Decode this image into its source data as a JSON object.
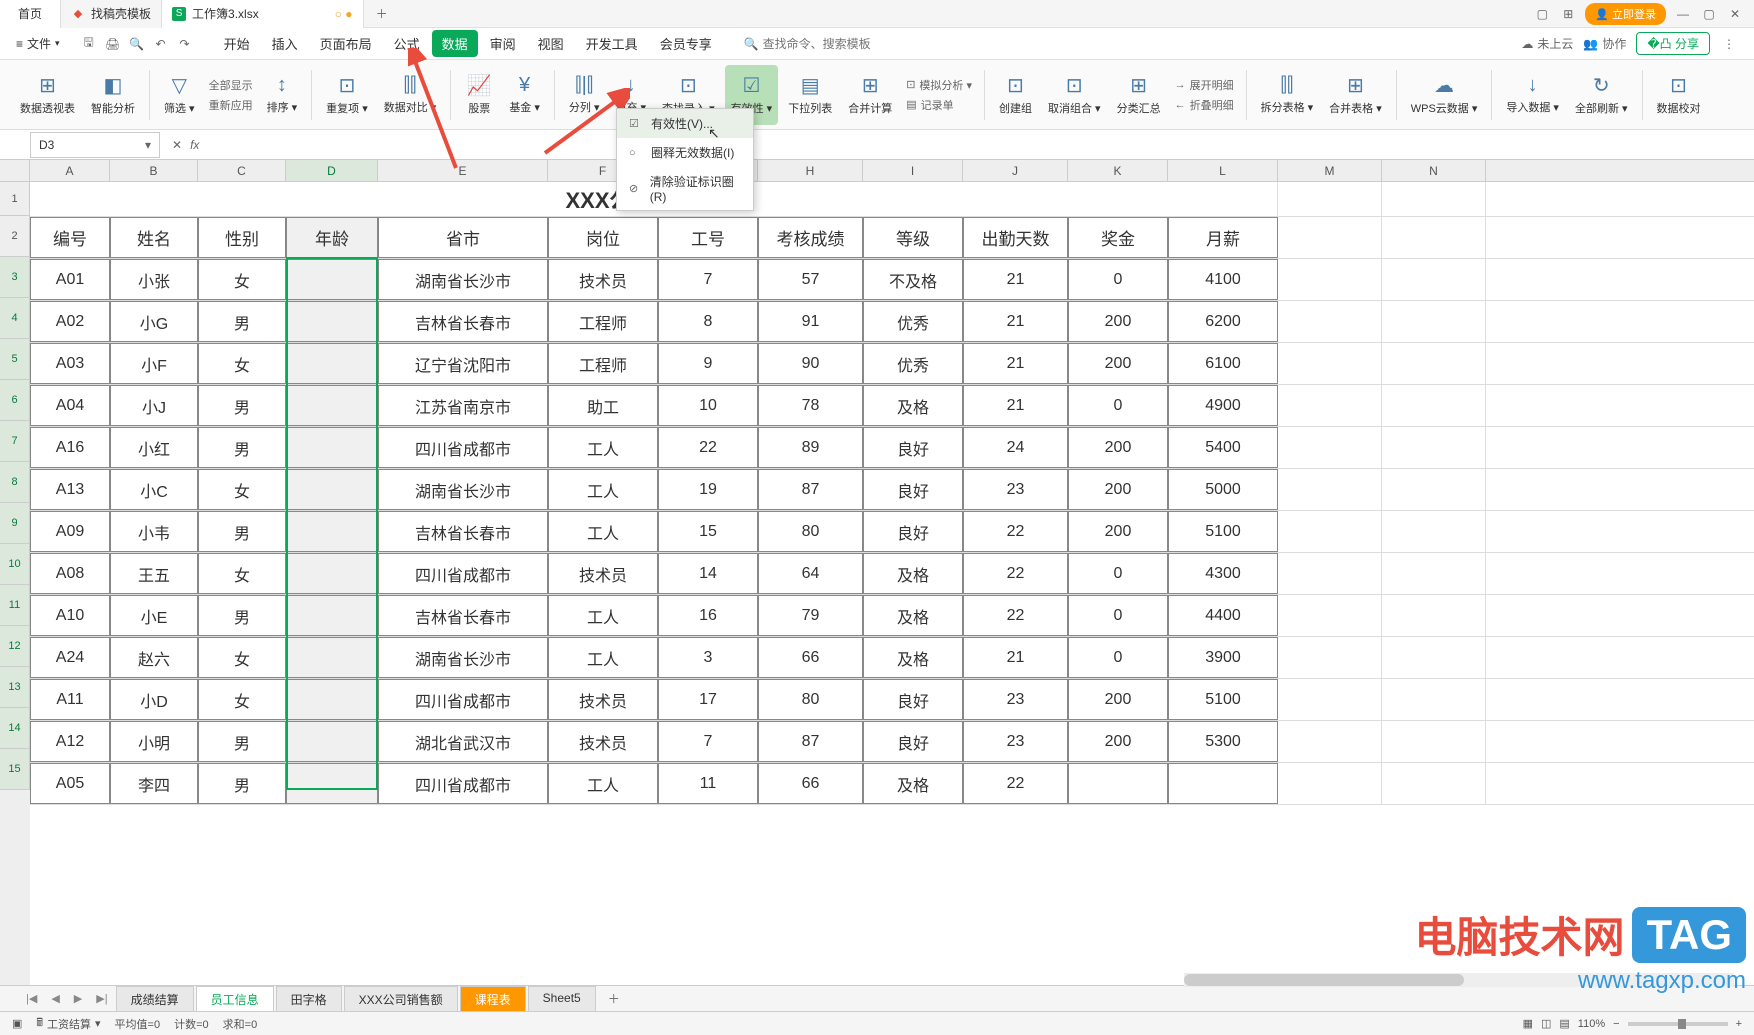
{
  "titlebar": {
    "home": "首页",
    "tab1": "找稿壳模板",
    "tab2": "工作簿3.xlsx",
    "login": "立即登录"
  },
  "menubar": {
    "file": "文件",
    "tabs": [
      "开始",
      "插入",
      "页面布局",
      "公式",
      "数据",
      "审阅",
      "视图",
      "开发工具",
      "会员专享"
    ],
    "active_idx": 4,
    "search_ph": "查找命令、搜索模板",
    "cloud": "未上云",
    "collab": "协作",
    "share": "分享"
  },
  "ribbon": {
    "items": [
      {
        "icon": "⊞",
        "label": "数据透视表"
      },
      {
        "icon": "◧",
        "label": "智能分析"
      },
      {
        "icon": "▽",
        "label": "筛选 ▾"
      },
      {
        "icon": "↕",
        "label": "排序 ▾"
      },
      {
        "icon": "⊡",
        "label": "重复项 ▾"
      },
      {
        "icon": "⫿⫿",
        "label": "数据对比 ▾"
      },
      {
        "icon": "📈",
        "label": "股票"
      },
      {
        "icon": "¥",
        "label": "基金 ▾"
      },
      {
        "icon": "⫿|⫿",
        "label": "分列 ▾"
      },
      {
        "icon": "↓",
        "label": "填充 ▾"
      },
      {
        "icon": "⊡",
        "label": "查找录入 ▾"
      },
      {
        "icon": "☑",
        "label": "有效性 ▾"
      },
      {
        "icon": "▤",
        "label": "下拉列表"
      },
      {
        "icon": "⊞",
        "label": "合并计算"
      },
      {
        "icon": "⊡",
        "label": "创建组"
      },
      {
        "icon": "⊡",
        "label": "取消组合 ▾"
      },
      {
        "icon": "⊞",
        "label": "分类汇总"
      },
      {
        "icon": "⫿⫿",
        "label": "拆分表格 ▾"
      },
      {
        "icon": "⊞",
        "label": "合并表格 ▾"
      },
      {
        "icon": "☁",
        "label": "WPS云数据 ▾"
      },
      {
        "icon": "↓",
        "label": "导入数据 ▾"
      },
      {
        "icon": "↻",
        "label": "全部刷新 ▾"
      },
      {
        "icon": "⊡",
        "label": "数据校对"
      }
    ],
    "stack1": [
      "全部显示",
      "重新应用"
    ],
    "stack2": [
      {
        "icon": "⊡",
        "label": "模拟分析 ▾"
      },
      {
        "icon": "▤",
        "label": "记录单"
      }
    ],
    "stack3": [
      {
        "icon": "→",
        "label": "展开明细"
      },
      {
        "icon": "←",
        "label": "折叠明细"
      }
    ]
  },
  "formula": {
    "cellref": "D3"
  },
  "dropdown": {
    "items": [
      {
        "icon": "☑",
        "label": "有效性(V)..."
      },
      {
        "icon": "○",
        "label": "圈释无效数据(I)"
      },
      {
        "icon": "⊘",
        "label": "清除验证标识圈(R)"
      }
    ]
  },
  "sheet": {
    "cols": [
      "A",
      "B",
      "C",
      "D",
      "E",
      "F",
      "G",
      "H",
      "I",
      "J",
      "K",
      "L",
      "M",
      "N"
    ],
    "widths": [
      80,
      88,
      88,
      92,
      170,
      110,
      100,
      105,
      100,
      105,
      100,
      110,
      104,
      104
    ],
    "title": "XXX公司员工信息",
    "headers": [
      "编号",
      "姓名",
      "性别",
      "年龄",
      "省市",
      "岗位",
      "工号",
      "考核成绩",
      "等级",
      "出勤天数",
      "奖金",
      "月薪"
    ],
    "rows": [
      [
        "A01",
        "小张",
        "女",
        "",
        "湖南省长沙市",
        "技术员",
        "7",
        "57",
        "不及格",
        "21",
        "0",
        "4100"
      ],
      [
        "A02",
        "小G",
        "男",
        "",
        "吉林省长春市",
        "工程师",
        "8",
        "91",
        "优秀",
        "21",
        "200",
        "6200"
      ],
      [
        "A03",
        "小F",
        "女",
        "",
        "辽宁省沈阳市",
        "工程师",
        "9",
        "90",
        "优秀",
        "21",
        "200",
        "6100"
      ],
      [
        "A04",
        "小J",
        "男",
        "",
        "江苏省南京市",
        "助工",
        "10",
        "78",
        "及格",
        "21",
        "0",
        "4900"
      ],
      [
        "A16",
        "小红",
        "男",
        "",
        "四川省成都市",
        "工人",
        "22",
        "89",
        "良好",
        "24",
        "200",
        "5400"
      ],
      [
        "A13",
        "小C",
        "女",
        "",
        "湖南省长沙市",
        "工人",
        "19",
        "87",
        "良好",
        "23",
        "200",
        "5000"
      ],
      [
        "A09",
        "小韦",
        "男",
        "",
        "吉林省长春市",
        "工人",
        "15",
        "80",
        "良好",
        "22",
        "200",
        "5100"
      ],
      [
        "A08",
        "王五",
        "女",
        "",
        "四川省成都市",
        "技术员",
        "14",
        "64",
        "及格",
        "22",
        "0",
        "4300"
      ],
      [
        "A10",
        "小E",
        "男",
        "",
        "吉林省长春市",
        "工人",
        "16",
        "79",
        "及格",
        "22",
        "0",
        "4400"
      ],
      [
        "A24",
        "赵六",
        "女",
        "",
        "湖南省长沙市",
        "工人",
        "3",
        "66",
        "及格",
        "21",
        "0",
        "3900"
      ],
      [
        "A11",
        "小D",
        "女",
        "",
        "四川省成都市",
        "技术员",
        "17",
        "80",
        "良好",
        "23",
        "200",
        "5100"
      ],
      [
        "A12",
        "小明",
        "男",
        "",
        "湖北省武汉市",
        "技术员",
        "7",
        "87",
        "良好",
        "23",
        "200",
        "5300"
      ],
      [
        "A05",
        "李四",
        "男",
        "",
        "四川省成都市",
        "工人",
        "11",
        "66",
        "及格",
        "22",
        "",
        ""
      ]
    ]
  },
  "sheettabs": {
    "tabs": [
      "成绩结算",
      "员工信息",
      "田字格",
      "XXX公司销售额",
      "课程表",
      "Sheet5"
    ],
    "active_idx": 1,
    "orange_idx": 4
  },
  "status": {
    "mode": "工资结算",
    "avg": "平均值=0",
    "count": "计数=0",
    "sum": "求和=0",
    "zoom": "110%"
  },
  "watermark": {
    "text": "电脑技术网",
    "tag": "TAG",
    "url": "www.tagxp.com"
  }
}
